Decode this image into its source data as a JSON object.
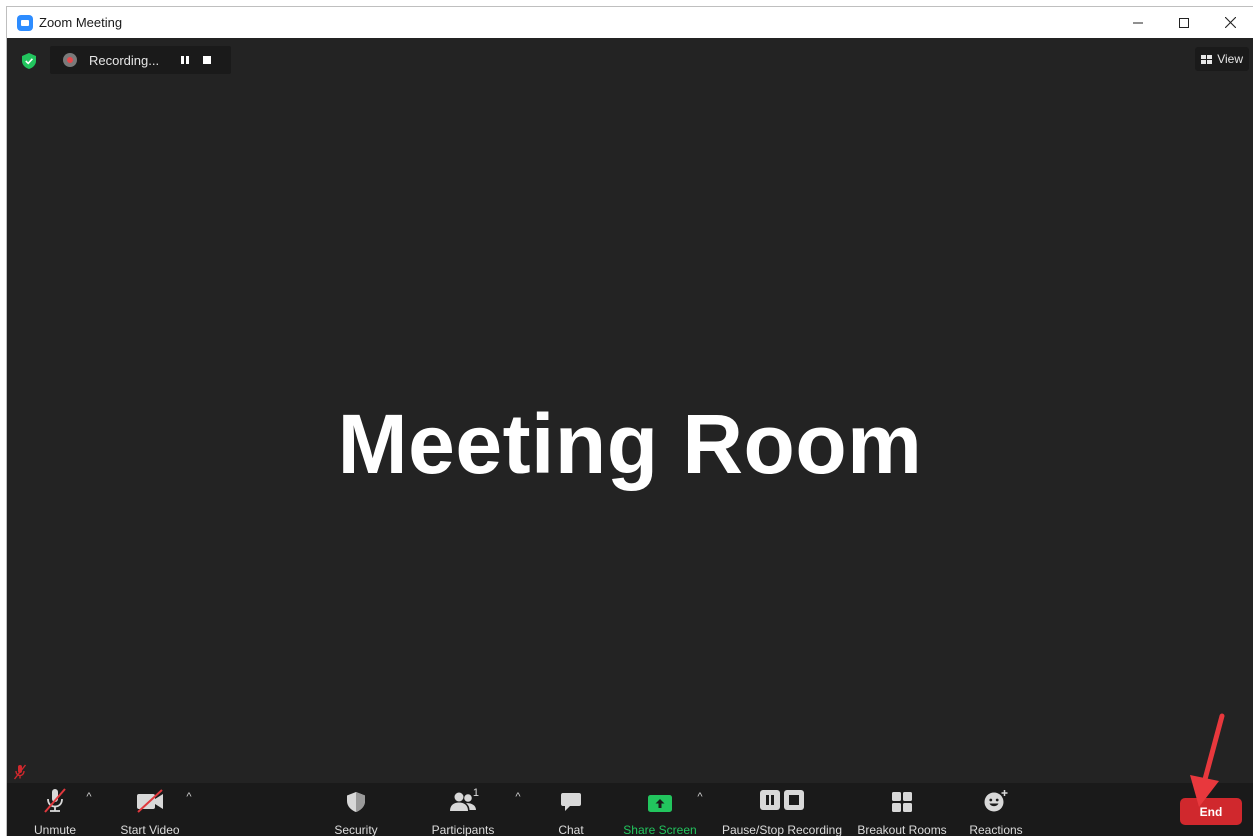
{
  "window": {
    "title": "Zoom Meeting",
    "controls": [
      "minimize-icon",
      "maximize-icon",
      "close-icon"
    ]
  },
  "meeting": {
    "recording_label": "Recording...",
    "view_label": "View",
    "room_text": "Meeting Room",
    "background_color": "#232323"
  },
  "toolbar": {
    "unmute_label": "Unmute",
    "start_video_label": "Start Video",
    "security_label": "Security",
    "participants_label": "Participants",
    "participants_count": "1",
    "chat_label": "Chat",
    "share_screen_label": "Share Screen",
    "recording_label": "Pause/Stop Recording",
    "breakout_label": "Breakout Rooms",
    "reactions_label": "Reactions",
    "end_label": "End"
  },
  "colors": {
    "accent_green": "#22c55e",
    "end_red": "#d0282d",
    "annotation_red": "#e8383d",
    "zoom_blue": "#2d8cff"
  }
}
